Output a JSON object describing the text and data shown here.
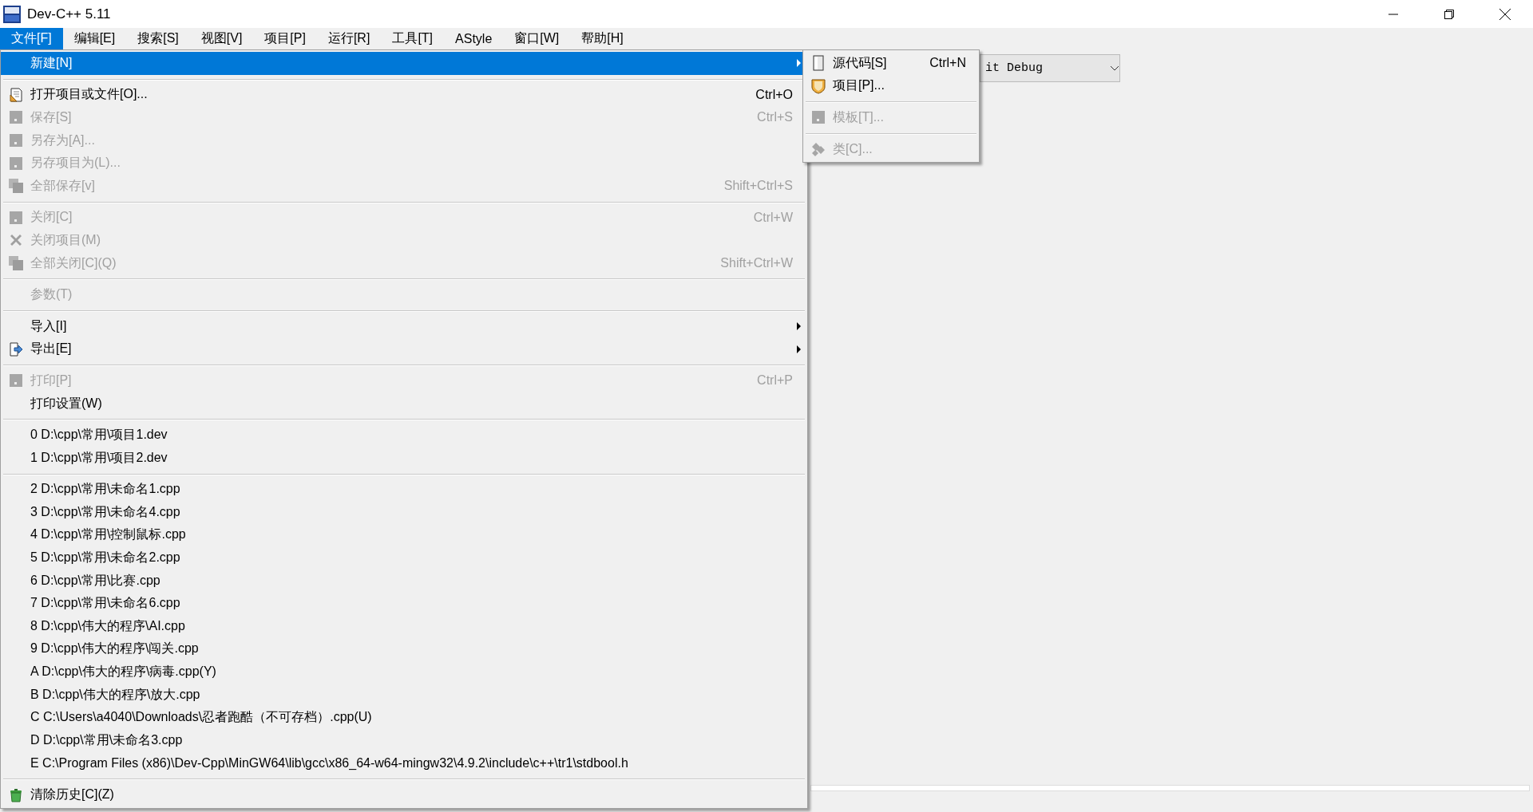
{
  "window": {
    "title": "Dev-C++ 5.11"
  },
  "menubar": [
    {
      "label": "文件[F]",
      "selected": true
    },
    {
      "label": "编辑[E]",
      "selected": false
    },
    {
      "label": "搜索[S]",
      "selected": false
    },
    {
      "label": "视图[V]",
      "selected": false
    },
    {
      "label": "项目[P]",
      "selected": false
    },
    {
      "label": "运行[R]",
      "selected": false
    },
    {
      "label": "工具[T]",
      "selected": false
    },
    {
      "label": "AStyle",
      "selected": false
    },
    {
      "label": "窗口[W]",
      "selected": false
    },
    {
      "label": "帮助[H]",
      "selected": false
    }
  ],
  "toolbar": {
    "build_config": "it Debug"
  },
  "menu": {
    "items": [
      {
        "kind": "item",
        "label": "新建[N]",
        "submenu": true,
        "selected": true,
        "disabled": false
      },
      {
        "kind": "separator"
      },
      {
        "kind": "item",
        "label": "打开项目或文件[O]...",
        "shortcut": "Ctrl+O",
        "selected": false,
        "disabled": false
      },
      {
        "kind": "item",
        "label": "保存[S]",
        "shortcut": "Ctrl+S",
        "selected": false,
        "disabled": true
      },
      {
        "kind": "item",
        "label": "另存为[A]...",
        "selected": false,
        "disabled": true
      },
      {
        "kind": "item",
        "label": "另存项目为(L)...",
        "selected": false,
        "disabled": true
      },
      {
        "kind": "item",
        "label": "全部保存[v]",
        "shortcut": "Shift+Ctrl+S",
        "selected": false,
        "disabled": true
      },
      {
        "kind": "separator"
      },
      {
        "kind": "item",
        "label": "关闭[C]",
        "shortcut": "Ctrl+W",
        "selected": false,
        "disabled": true
      },
      {
        "kind": "item",
        "label": "关闭项目(M)",
        "selected": false,
        "disabled": true
      },
      {
        "kind": "item",
        "label": "全部关闭[C](Q)",
        "shortcut": "Shift+Ctrl+W",
        "selected": false,
        "disabled": true
      },
      {
        "kind": "separator"
      },
      {
        "kind": "item",
        "label": "参数(T)",
        "selected": false,
        "disabled": true
      },
      {
        "kind": "separator"
      },
      {
        "kind": "item",
        "label": "导入[I]",
        "submenu": true,
        "selected": false,
        "disabled": false
      },
      {
        "kind": "item",
        "label": "导出[E]",
        "submenu": true,
        "selected": false,
        "disabled": false
      },
      {
        "kind": "separator"
      },
      {
        "kind": "item",
        "label": "打印[P]",
        "shortcut": "Ctrl+P",
        "selected": false,
        "disabled": true
      },
      {
        "kind": "item",
        "label": "打印设置(W)",
        "selected": false,
        "disabled": false
      },
      {
        "kind": "separator"
      },
      {
        "kind": "item",
        "label": "0 D:\\cpp\\常用\\项目1.dev",
        "selected": false,
        "disabled": false
      },
      {
        "kind": "item",
        "label": "1 D:\\cpp\\常用\\项目2.dev",
        "selected": false,
        "disabled": false
      },
      {
        "kind": "separator"
      },
      {
        "kind": "item",
        "label": "2 D:\\cpp\\常用\\未命名1.cpp",
        "selected": false,
        "disabled": false
      },
      {
        "kind": "item",
        "label": "3 D:\\cpp\\常用\\未命名4.cpp",
        "selected": false,
        "disabled": false
      },
      {
        "kind": "item",
        "label": "4 D:\\cpp\\常用\\控制鼠标.cpp",
        "selected": false,
        "disabled": false
      },
      {
        "kind": "item",
        "label": "5 D:\\cpp\\常用\\未命名2.cpp",
        "selected": false,
        "disabled": false
      },
      {
        "kind": "item",
        "label": "6 D:\\cpp\\常用\\比赛.cpp",
        "selected": false,
        "disabled": false
      },
      {
        "kind": "item",
        "label": "7 D:\\cpp\\常用\\未命名6.cpp",
        "selected": false,
        "disabled": false
      },
      {
        "kind": "item",
        "label": "8 D:\\cpp\\伟大的程序\\AI.cpp",
        "selected": false,
        "disabled": false
      },
      {
        "kind": "item",
        "label": "9 D:\\cpp\\伟大的程序\\闯关.cpp",
        "selected": false,
        "disabled": false
      },
      {
        "kind": "item",
        "label": "A D:\\cpp\\伟大的程序\\病毒.cpp(Y)",
        "selected": false,
        "disabled": false
      },
      {
        "kind": "item",
        "label": "B D:\\cpp\\伟大的程序\\放大.cpp",
        "selected": false,
        "disabled": false
      },
      {
        "kind": "item",
        "label": "C C:\\Users\\a4040\\Downloads\\忍者跑酷（不可存档）.cpp(U)",
        "selected": false,
        "disabled": false
      },
      {
        "kind": "item",
        "label": "D D:\\cpp\\常用\\未命名3.cpp",
        "selected": false,
        "disabled": false
      },
      {
        "kind": "item",
        "label": "E C:\\Program Files (x86)\\Dev-Cpp\\MinGW64\\lib\\gcc\\x86_64-w64-mingw32\\4.9.2\\include\\c++\\tr1\\stdbool.h",
        "selected": false,
        "disabled": false
      },
      {
        "kind": "separator"
      },
      {
        "kind": "item",
        "label": "清除历史[C](Z)",
        "selected": false,
        "disabled": false
      }
    ]
  },
  "submenu": {
    "items": [
      {
        "kind": "item",
        "label": "源代码[S]",
        "shortcut": "Ctrl+N",
        "selected": false,
        "disabled": false
      },
      {
        "kind": "item",
        "label": "项目[P]...",
        "selected": false,
        "disabled": false
      },
      {
        "kind": "separator"
      },
      {
        "kind": "item",
        "label": "模板[T]...",
        "selected": false,
        "disabled": true
      },
      {
        "kind": "separator"
      },
      {
        "kind": "item",
        "label": "类[C]...",
        "selected": false,
        "disabled": true
      }
    ]
  }
}
